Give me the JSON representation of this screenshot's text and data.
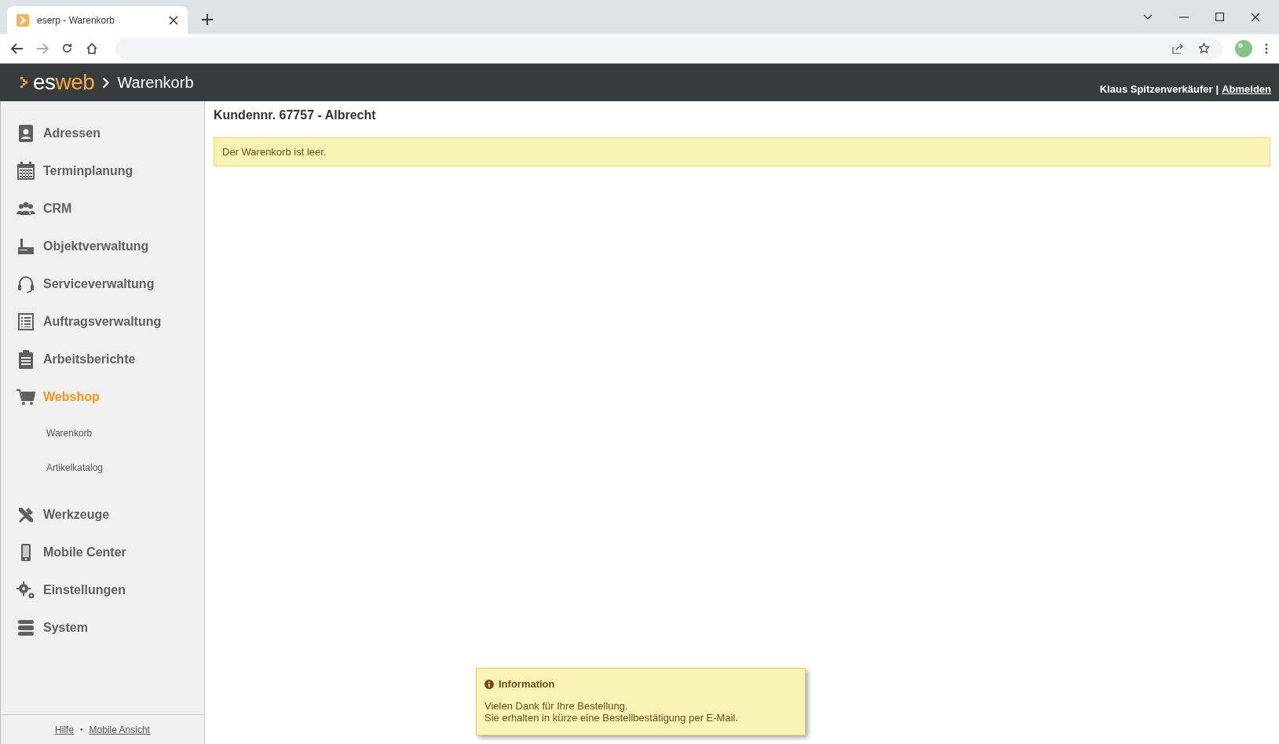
{
  "browser": {
    "tab_title": "eserp - Warenkorb"
  },
  "header": {
    "logo": {
      "part_1": "es",
      "part_2": "web"
    },
    "breadcrumb": "Warenkorb",
    "user": "Klaus Spitzenverkäufer",
    "separator": "|",
    "logout": "Abmelden"
  },
  "sidebar": {
    "items": [
      {
        "label": "Adressen",
        "selected": false
      },
      {
        "label": "Terminplanung",
        "selected": false
      },
      {
        "label": "CRM",
        "selected": false
      },
      {
        "label": "Objektverwaltung",
        "selected": false
      },
      {
        "label": "Serviceverwaltung",
        "selected": false
      },
      {
        "label": "Auftragsverwaltung",
        "selected": false
      },
      {
        "label": "Arbeitsberichte",
        "selected": false
      },
      {
        "label": "Webshop",
        "selected": true,
        "children": [
          {
            "label": "Warenkorb",
            "selected": false
          },
          {
            "label": "Artikelkatalog",
            "selected": false
          }
        ]
      },
      {
        "label": "Werkzeuge",
        "selected": false
      },
      {
        "label": "Mobile Center",
        "selected": false
      },
      {
        "label": "Einstellungen",
        "selected": false
      },
      {
        "label": "System",
        "selected": false
      }
    ],
    "footer": {
      "links": [
        "Hilfe",
        "Mobile Ansicht"
      ],
      "separator": "•"
    }
  },
  "main": {
    "title": "Kundennr. 67757 - Albrecht",
    "notice": "Der Warenkorb ist leer."
  },
  "toast": {
    "title": "Information",
    "lines": [
      "Vielen Dank für Ihre Bestellung.",
      "Sie erhalten in kürze eine Bestellbestätigung per E-Mail."
    ]
  }
}
